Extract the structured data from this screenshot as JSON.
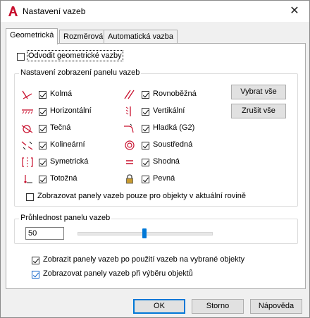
{
  "window": {
    "title": "Nastavení vazeb",
    "close_glyph": "✕"
  },
  "tabs": [
    {
      "label": "Geometrická",
      "active": true
    },
    {
      "label": "Rozměrová",
      "active": false
    },
    {
      "label": "Automatická vazba",
      "active": false
    }
  ],
  "infer": {
    "label": "Odvodit geometrické vazby",
    "checked": false
  },
  "bar_group": {
    "title": "Nastavení zobrazení panelu vazeb",
    "left": [
      {
        "label": "Kolmá",
        "icon": "perpendicular-icon",
        "checked": true
      },
      {
        "label": "Horizontální",
        "icon": "horizontal-icon",
        "checked": true
      },
      {
        "label": "Tečná",
        "icon": "tangent-icon",
        "checked": true
      },
      {
        "label": "Kolineární",
        "icon": "collinear-icon",
        "checked": true
      },
      {
        "label": "Symetrická",
        "icon": "symmetric-icon",
        "checked": true
      },
      {
        "label": "Totožná",
        "icon": "coincident-icon",
        "checked": true
      }
    ],
    "right": [
      {
        "label": "Rovnoběžná",
        "icon": "parallel-icon",
        "checked": true
      },
      {
        "label": "Vertikální",
        "icon": "vertical-icon",
        "checked": true
      },
      {
        "label": "Hladká (G2)",
        "icon": "smooth-icon",
        "checked": true
      },
      {
        "label": "Soustředná",
        "icon": "concentric-icon",
        "checked": true
      },
      {
        "label": "Shodná",
        "icon": "equal-icon",
        "checked": true
      },
      {
        "label": "Pevná",
        "icon": "fixed-lock-icon",
        "checked": true
      }
    ],
    "select_all": "Vybrat vše",
    "clear_all": "Zrušit vše",
    "only_current_plane": {
      "label": "Zobrazovat panely vazeb pouze pro objekty v aktuální rovině",
      "checked": false
    }
  },
  "transparency": {
    "title": "Průhlednost panelu vazeb",
    "value": "50",
    "percent": 50
  },
  "show_after_apply": {
    "label": "Zobrazit panely vazeb po použití vazeb na vybrané objekty",
    "checked": true
  },
  "show_on_select": {
    "label": "Zobrazovat panely vazeb při výběru objektů",
    "checked": true
  },
  "buttons": {
    "ok": "OK",
    "cancel": "Storno",
    "help": "Nápověda"
  },
  "colors": {
    "accent": "#0078d7",
    "icon_red": "#c8102e"
  }
}
